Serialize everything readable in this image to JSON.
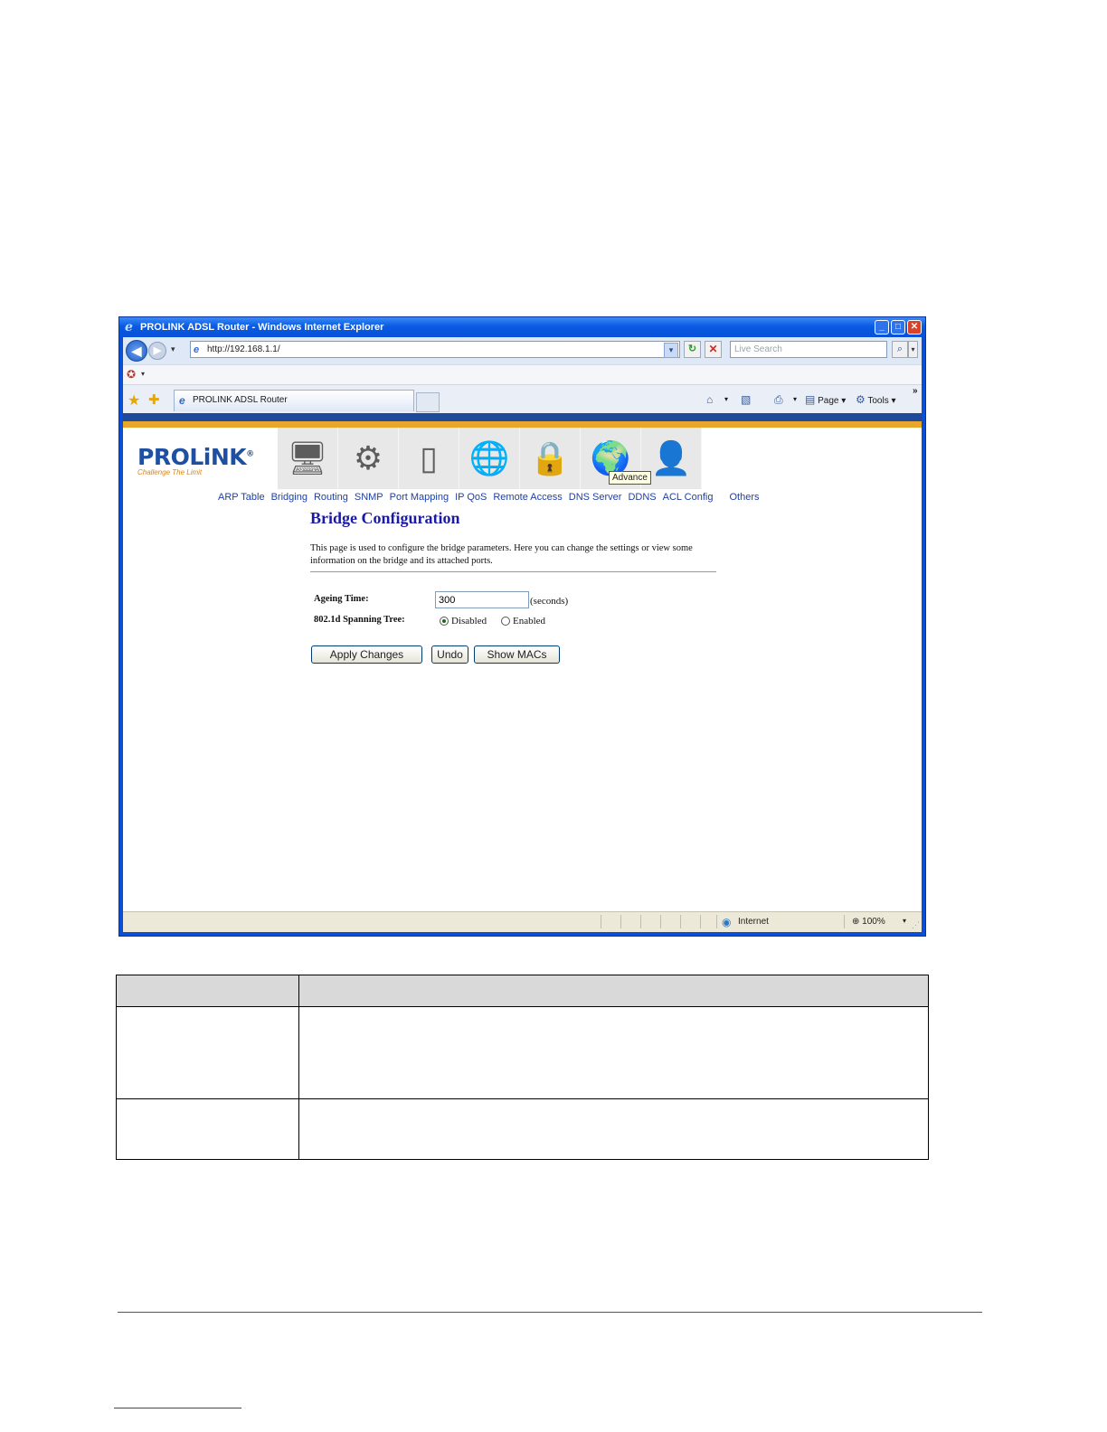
{
  "window": {
    "title": "PROLINK ADSL Router - Windows Internet Explorer",
    "minimize": "_",
    "maximize": "□",
    "close": "✕"
  },
  "toolbar": {
    "address": "http://192.168.1.1/",
    "search_placeholder": "Live Search",
    "back": "◀",
    "forward": "▶",
    "dropdown": "▾",
    "refresh": "↻",
    "stop": "✕",
    "search_go": "⌕"
  },
  "tabs": {
    "current_tab": "PROLINK ADSL Router",
    "commands": {
      "page": "Page",
      "tools": "Tools",
      "more": "»"
    }
  },
  "brand": {
    "logo": "PROLiNK",
    "registered": "®",
    "tagline": "Challenge The Limit"
  },
  "nav_icons": [
    {
      "name": "status",
      "glyph": "🖥"
    },
    {
      "name": "setup",
      "glyph": "⚙"
    },
    {
      "name": "service",
      "glyph": "▯"
    },
    {
      "name": "internet",
      "glyph": "🌐"
    },
    {
      "name": "security",
      "glyph": "🔒"
    },
    {
      "name": "advance",
      "glyph": "🌍"
    },
    {
      "name": "admin",
      "glyph": "👤"
    }
  ],
  "tooltip": "Advance",
  "submenu": [
    "ARP Table",
    "Bridging",
    "Routing",
    "SNMP",
    "Port Mapping",
    "IP QoS",
    "Remote Access",
    "DNS Server",
    "DDNS",
    "ACL Config",
    "Others"
  ],
  "page": {
    "title": "Bridge Configuration",
    "description": "This page is used to configure the bridge parameters. Here you can change the settings or view some information on the bridge and its attached ports."
  },
  "form": {
    "ageing_label": "Ageing Time:",
    "ageing_value": "300",
    "ageing_unit": "(seconds)",
    "stp_label": "802.1d Spanning Tree:",
    "stp_disabled": "Disabled",
    "stp_enabled": "Enabled",
    "stp_selected": "Disabled"
  },
  "buttons": {
    "apply": "Apply Changes",
    "undo": "Undo",
    "show_macs": "Show MACs"
  },
  "statusbar": {
    "zone": "Internet",
    "zoom": "100%"
  },
  "colors": {
    "title_blue": "#1a1aa8",
    "link_blue": "#1d3fa5",
    "stripe_blue": "#1f4a9b",
    "stripe_orange": "#e8a72a"
  }
}
